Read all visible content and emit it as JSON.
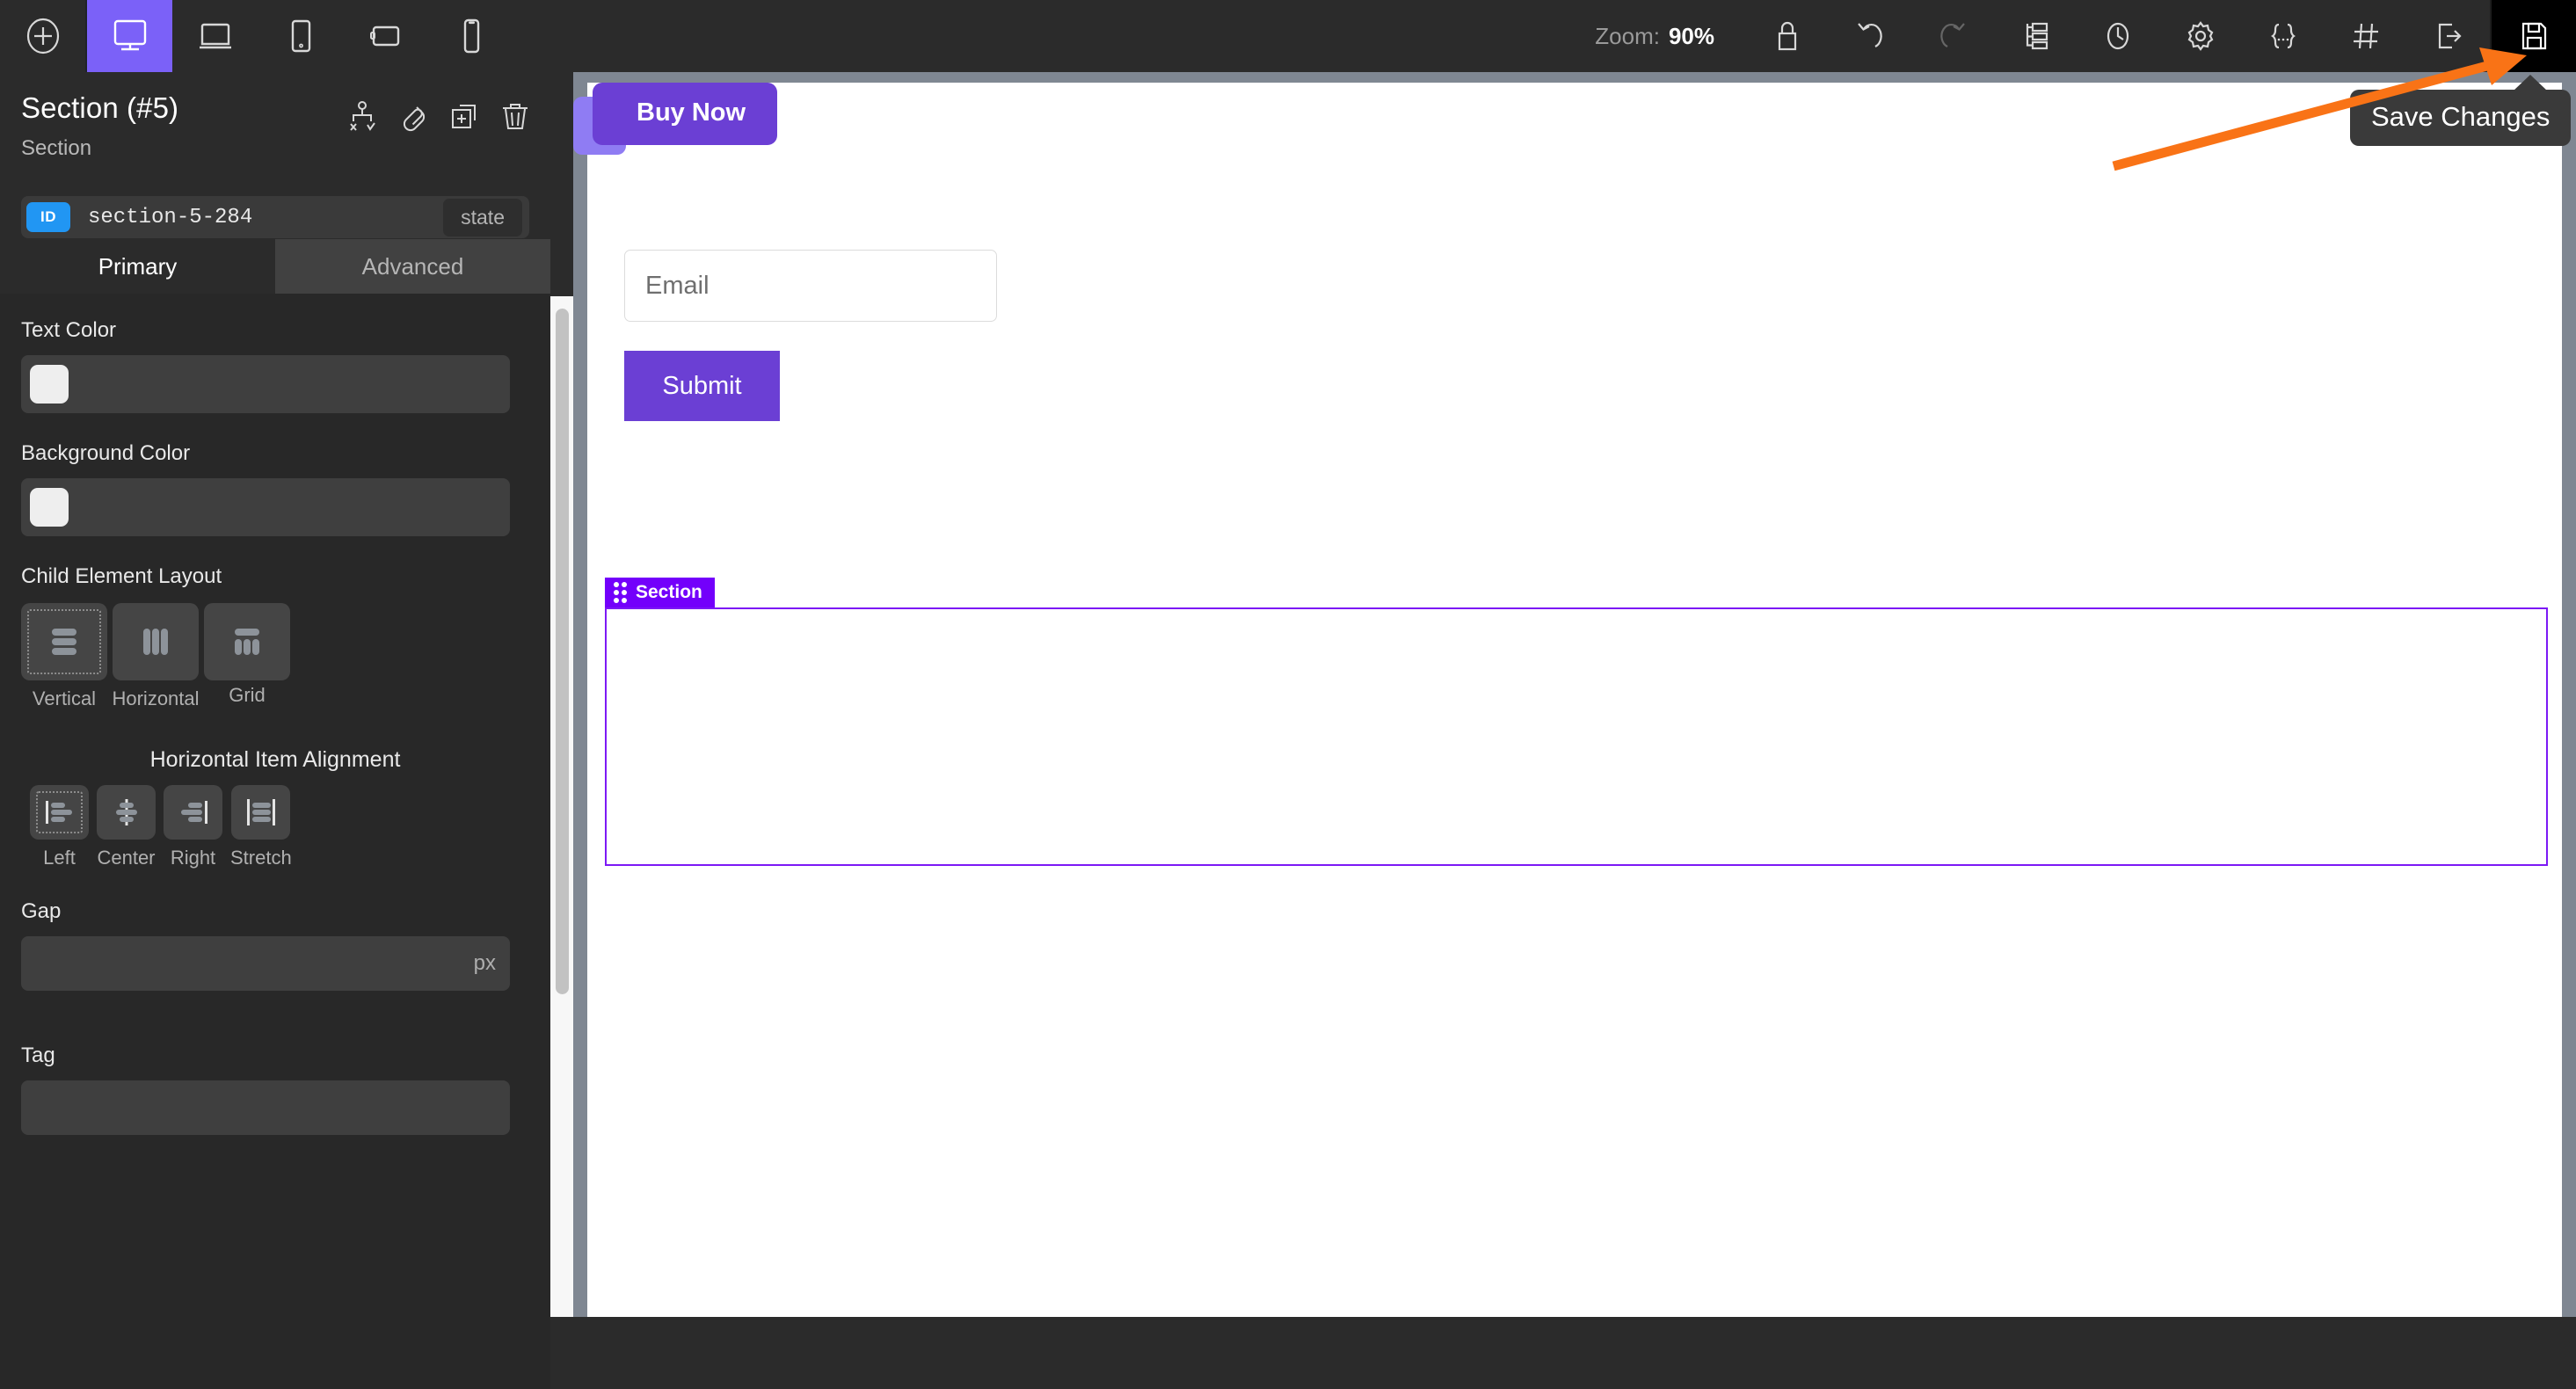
{
  "toolbar": {
    "add_label": "add-element",
    "devices": [
      {
        "name": "desktop",
        "icon": "desktop-icon",
        "active": true
      },
      {
        "name": "laptop",
        "icon": "laptop-icon",
        "active": false
      },
      {
        "name": "tablet",
        "icon": "tablet-icon",
        "active": false
      },
      {
        "name": "tablet-landscape",
        "icon": "tablet-landscape-icon",
        "active": false
      },
      {
        "name": "mobile",
        "icon": "mobile-icon",
        "active": false
      }
    ],
    "zoom_label": "Zoom:",
    "zoom_value": "90%",
    "actions": [
      {
        "name": "lock-icon",
        "label": "Lock"
      },
      {
        "name": "undo-icon",
        "label": "Undo"
      },
      {
        "name": "redo-icon",
        "label": "Redo"
      },
      {
        "name": "layers-icon",
        "label": "Layers"
      },
      {
        "name": "history-icon",
        "label": "History"
      },
      {
        "name": "settings-gear-icon",
        "label": "Settings"
      },
      {
        "name": "code-braces-icon",
        "label": "Code"
      },
      {
        "name": "grid-icon",
        "label": "Grid"
      },
      {
        "name": "export-icon",
        "label": "Export"
      },
      {
        "name": "save-icon",
        "label": "Save"
      }
    ]
  },
  "tooltip": {
    "text": "Save Changes"
  },
  "panel": {
    "title": "Section (#5)",
    "subtitle": "Section",
    "header_icons": [
      {
        "name": "conditions-icon",
        "label": "Conditions"
      },
      {
        "name": "link-icon",
        "label": "Link"
      },
      {
        "name": "duplicate-icon",
        "label": "Duplicate"
      },
      {
        "name": "delete-icon",
        "label": "Delete"
      }
    ],
    "id_badge": "ID",
    "id_value": "section-5-284",
    "state_button": "state",
    "tabs": [
      {
        "label": "Primary",
        "active": true
      },
      {
        "label": "Advanced",
        "active": false
      }
    ],
    "text_color": {
      "label": "Text Color",
      "value": "#eeeeee"
    },
    "background_color": {
      "label": "Background Color",
      "value": "#eeeeee"
    },
    "child_layout": {
      "label": "Child Element Layout",
      "options": [
        {
          "label": "Vertical",
          "icon": "layout-vertical-icon",
          "selected": true
        },
        {
          "label": "Horizontal",
          "icon": "layout-horizontal-icon",
          "selected": false
        },
        {
          "label": "Grid",
          "icon": "layout-grid-icon",
          "selected": false
        }
      ]
    },
    "horizontal_alignment": {
      "label": "Horizontal Item Alignment",
      "options": [
        {
          "label": "Left",
          "icon": "align-left-icon",
          "selected": true
        },
        {
          "label": "Center",
          "icon": "align-center-icon",
          "selected": false
        },
        {
          "label": "Right",
          "icon": "align-right-icon",
          "selected": false
        },
        {
          "label": "Stretch",
          "icon": "align-stretch-icon",
          "selected": false
        }
      ]
    },
    "gap": {
      "label": "Gap",
      "value": "",
      "unit": "px"
    },
    "tag": {
      "label": "Tag",
      "value": ""
    }
  },
  "canvas": {
    "buy_now_button": "Buy Now",
    "collapse_icon": "chevron-left-icon",
    "email_field": {
      "placeholder": "Email",
      "value": ""
    },
    "submit_button": "Submit",
    "section_badge": "Section",
    "accent_purple": "#7300fb"
  }
}
